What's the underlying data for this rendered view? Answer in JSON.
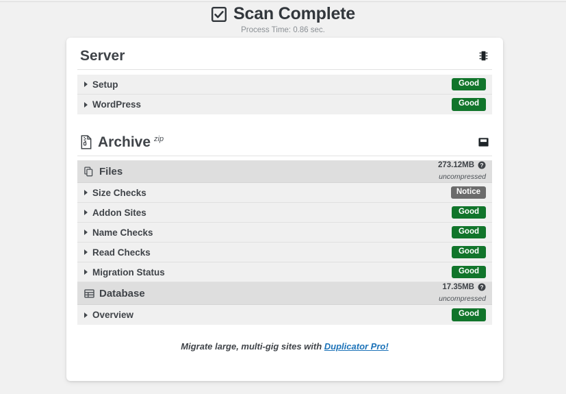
{
  "header": {
    "title": "Scan Complete",
    "check_icon": "checkbox-checked-icon",
    "process_time": "Process Time: 0.86 sec."
  },
  "sections": [
    {
      "key": "server",
      "title": "Server",
      "superscript": "",
      "title_icon": "microchip-icon",
      "right_icon": "microchip-icon",
      "rows": [
        {
          "label": "Setup",
          "status": "Good",
          "status_type": "good"
        },
        {
          "label": "WordPress",
          "status": "Good",
          "status_type": "good"
        }
      ]
    },
    {
      "key": "archive",
      "title": "Archive",
      "superscript": "zip",
      "title_icon": "file-archive-icon",
      "right_icon": "save-icon",
      "groups": [
        {
          "label": "Files",
          "icon": "files-copy-icon",
          "size": "273.12MB",
          "size_note": "uncompressed",
          "help_icon": "question-circle-icon",
          "rows": [
            {
              "label": "Size Checks",
              "status": "Notice",
              "status_type": "notice"
            },
            {
              "label": "Addon Sites",
              "status": "Good",
              "status_type": "good"
            },
            {
              "label": "Name Checks",
              "status": "Good",
              "status_type": "good"
            },
            {
              "label": "Read Checks",
              "status": "Good",
              "status_type": "good"
            },
            {
              "label": "Migration Status",
              "status": "Good",
              "status_type": "good"
            }
          ]
        },
        {
          "label": "Database",
          "icon": "table-grid-icon",
          "size": "17.35MB",
          "size_note": "uncompressed",
          "help_icon": "question-circle-icon",
          "rows": [
            {
              "label": "Overview",
              "status": "Good",
              "status_type": "good"
            }
          ]
        }
      ]
    }
  ],
  "footer": {
    "text_before": "Migrate large, multi-gig sites with ",
    "link_text": "Duplicator Pro!"
  },
  "colors": {
    "good_badge": "#11752b",
    "notice_badge": "#6b6b6b",
    "link": "#1b72b8",
    "page_bg": "#f1f1f1",
    "card_bg": "#ffffff",
    "row_bg": "#f0f0f0",
    "group_row_bg": "#dedede"
  }
}
